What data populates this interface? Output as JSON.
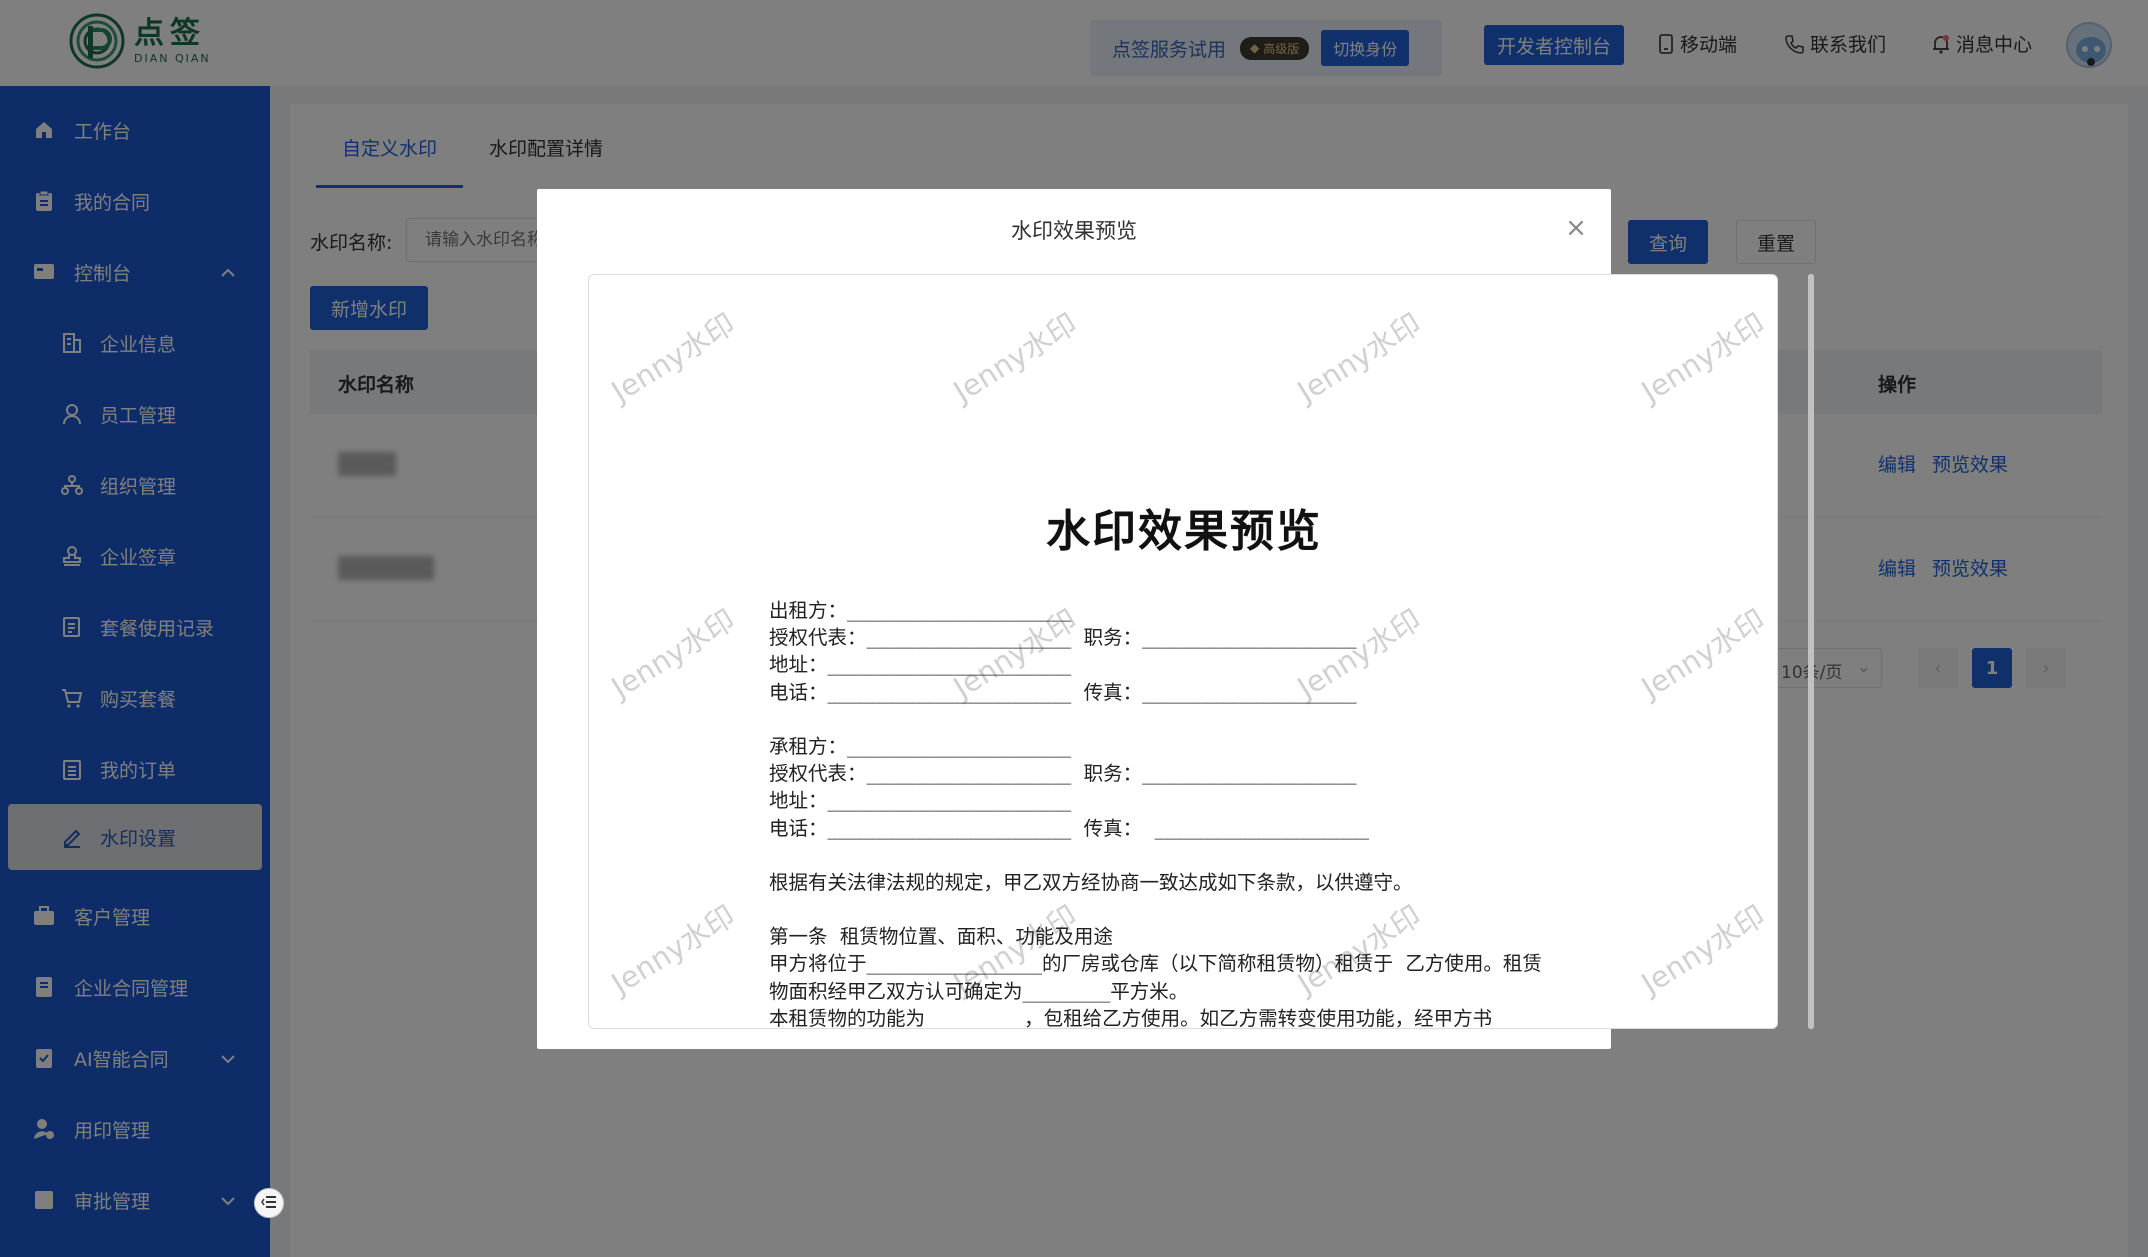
{
  "header": {
    "logo_cn": "点签",
    "logo_en": "DIAN QIAN",
    "trial_text": "点签服务试用",
    "vip_badge": "高级版",
    "switch_identity": "切换身份",
    "dev_console": "开发者控制台",
    "mobile": "移动端",
    "contact": "联系我们",
    "messages": "消息中心"
  },
  "sidebar": {
    "items": [
      {
        "label": "工作台",
        "icon": "home-icon"
      },
      {
        "label": "我的合同",
        "icon": "clipboard-icon"
      },
      {
        "label": "控制台",
        "icon": "console-icon",
        "expanded": true
      },
      {
        "label": "企业信息",
        "icon": "building-icon"
      },
      {
        "label": "员工管理",
        "icon": "user-icon"
      },
      {
        "label": "组织管理",
        "icon": "org-icon"
      },
      {
        "label": "企业签章",
        "icon": "stamp-icon"
      },
      {
        "label": "套餐使用记录",
        "icon": "record-icon"
      },
      {
        "label": "购买套餐",
        "icon": "cart-icon"
      },
      {
        "label": "我的订单",
        "icon": "order-icon"
      },
      {
        "label": "水印设置",
        "icon": "pen-icon",
        "active": true
      },
      {
        "label": "客户管理",
        "icon": "briefcase-icon"
      },
      {
        "label": "企业合同管理",
        "icon": "contract-icon"
      },
      {
        "label": "AI智能合同",
        "icon": "ai-contract-icon"
      },
      {
        "label": "用印管理",
        "icon": "seal-user-icon"
      },
      {
        "label": "审批管理",
        "icon": "approval-icon"
      }
    ]
  },
  "main": {
    "tabs": [
      "自定义水印",
      "水印配置详情"
    ],
    "search_label": "水印名称:",
    "search_placeholder": "请输入水印名称",
    "query_btn": "查询",
    "reset_btn": "重置",
    "add_btn": "新增水印",
    "columns": [
      "水印名称",
      "操作"
    ],
    "row_actions": [
      "编辑",
      "预览效果"
    ],
    "page_size": "10条/页",
    "current_page": "1"
  },
  "modal": {
    "title": "水印效果预览",
    "watermark_text": "Jenny水印",
    "doc_title": "水印效果预览",
    "doc_lines": [
      "出租方：_______________________",
      "授权代表：_____________________  职务：______________________",
      "地址：_________________________",
      "电话：_________________________  传真：______________________",
      "",
      "承租方：_______________________",
      "授权代表：_____________________  职务：______________________",
      "地址：_________________________",
      "电话：_________________________  传真：  ______________________",
      "",
      "根据有关法律法规的规定，甲乙双方经协商一致达成如下条款，以供遵守。",
      "",
      "第一条  租赁物位置、面积、功能及用途",
      "甲方将位于__________________的厂房或仓库（以下简称租赁物）租赁于  乙方使用。租赁",
      "物面积经甲乙双方认可确定为_________平方米。",
      "本租赁物的功能为                ，包租给乙方使用。如乙方需转变使用功能，经甲方书"
    ]
  }
}
